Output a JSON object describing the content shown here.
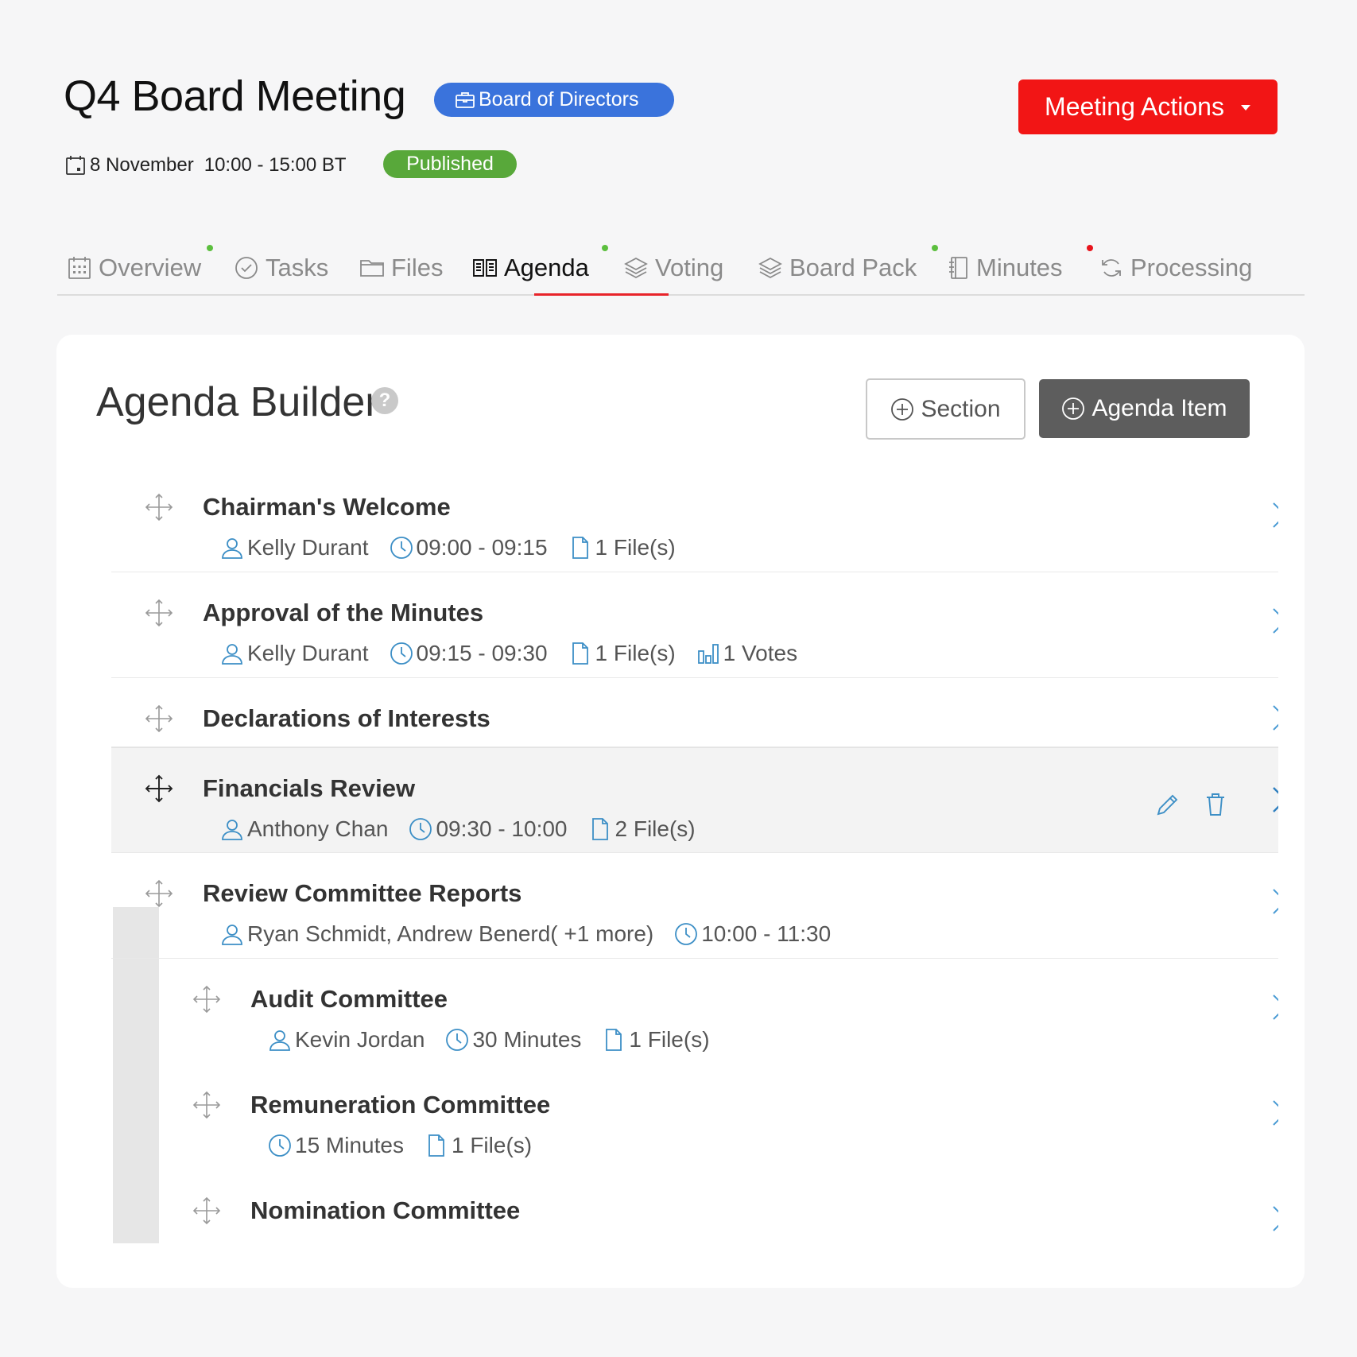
{
  "header": {
    "title": "Q4 Board Meeting",
    "group_badge": "Board of Directors",
    "date": "8 November",
    "time": "10:00 - 15:00 BT",
    "status": "Published",
    "actions_label": "Meeting Actions"
  },
  "tabs": [
    {
      "label": "Overview",
      "icon": "calendar-grid-icon",
      "dot": "green"
    },
    {
      "label": "Tasks",
      "icon": "check-circle-icon",
      "dot": null
    },
    {
      "label": "Files",
      "icon": "folder-icon",
      "dot": null
    },
    {
      "label": "Agenda",
      "icon": "book-icon",
      "dot": "green",
      "active": true
    },
    {
      "label": "Voting",
      "icon": "layers-icon",
      "dot": null
    },
    {
      "label": "Board Pack",
      "icon": "layers-icon",
      "dot": "green"
    },
    {
      "label": "Minutes",
      "icon": "notebook-icon",
      "dot": "red"
    },
    {
      "label": "Processing",
      "icon": "refresh-icon",
      "dot": null
    }
  ],
  "agenda": {
    "title": "Agenda Builder",
    "help_icon": "question-circle-icon",
    "section_button": "Section",
    "item_button": "Agenda Item",
    "items": [
      {
        "title": "Chairman's Welcome",
        "presenter": "Kelly Durant",
        "time": "09:00 - 09:15",
        "files": "1 File(s)"
      },
      {
        "title": "Approval of the Minutes",
        "presenter": "Kelly Durant",
        "time": "09:15 - 09:30",
        "files": "1 File(s)",
        "votes": "1 Votes"
      },
      {
        "title": "Declarations of Interests"
      },
      {
        "title": "Financials Review",
        "presenter": "Anthony Chan",
        "time": "09:30 - 10:00",
        "files": "2 File(s)",
        "selected": true
      },
      {
        "title": "Review Committee Reports",
        "presenter": "Ryan Schmidt, Andrew Benerd( +1 more)",
        "time": "10:00 - 11:30"
      },
      {
        "title": "Audit Committee",
        "presenter": "Kevin Jordan",
        "time": "30 Minutes",
        "files": "1 File(s)",
        "sub": true
      },
      {
        "title": "Remuneration Committee",
        "time": "15 Minutes",
        "files": "1 File(s)",
        "sub": true
      },
      {
        "title": "Nomination Committee",
        "sub": true
      }
    ]
  },
  "colors": {
    "accent_red": "#f21515",
    "badge_blue": "#3a73dc",
    "status_green": "#58a83a",
    "link_blue": "#3d8fc6",
    "dark_button": "#5d5d5d"
  }
}
